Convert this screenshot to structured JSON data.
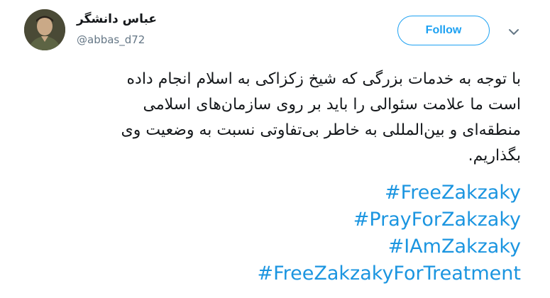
{
  "user": {
    "display_name": "عباس دانشگر",
    "handle": "@abbas_d72"
  },
  "actions": {
    "follow_label": "Follow",
    "caret_icon": "chevron-down-icon"
  },
  "tweet": {
    "text_lines": [
      "با توجه به خدمات بزرگی که شیخ زکزاکی به اسلام انجام داده",
      "است ما علامت سئوالی را باید بر روی سازمان‌های اسلامی",
      "منطقه‌ای و بین‌المللی به خاطر بی‌تفاوتی نسبت به وضعیت وی",
      "بگذاریم."
    ],
    "hashtags": [
      "#FreeZakzaky",
      "#PrayForZakzaky",
      "#IAmZakzaky",
      "#FreeZakzakyForTreatment"
    ]
  },
  "colors": {
    "brand_blue": "#1da1f2",
    "link_blue": "#1b95e0",
    "text": "#14171a",
    "secondary_text": "#657786"
  }
}
